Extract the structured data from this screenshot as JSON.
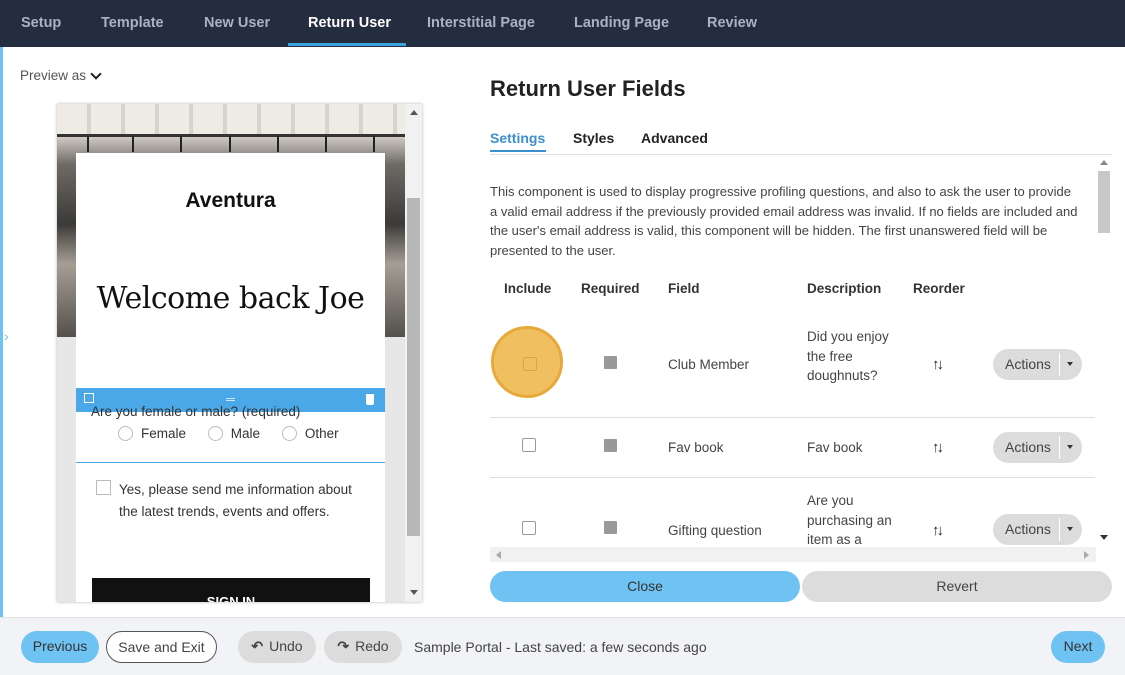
{
  "topnav": {
    "tabs": [
      "Setup",
      "Template",
      "New User",
      "Return User",
      "Interstitial Page",
      "Landing Page",
      "Review"
    ],
    "active": "Return User"
  },
  "preview": {
    "label": "Preview as",
    "brand": "Aventura",
    "welcome": "Welcome back Joe",
    "question": "Are you female or male? (required)",
    "options": [
      "Female",
      "Male",
      "Other"
    ],
    "optin": "Yes, please send me information about the latest trends, events and offers.",
    "signin": "SIGN IN"
  },
  "panel": {
    "title": "Return User Fields",
    "tabs": [
      "Settings",
      "Styles",
      "Advanced"
    ],
    "description": "This component is used to display progressive profiling questions, and also to ask the user to provide a valid email address if the previously provided email address was invalid. If no fields are included and the user's email address is valid, this component will be hidden. The first unanswered field will be presented to the user.",
    "columns": [
      "Include",
      "Required",
      "Field",
      "Description",
      "Reorder"
    ],
    "rows": [
      {
        "field": "Club Member",
        "description": "Did you enjoy the free doughnuts?",
        "action": "Actions"
      },
      {
        "field": "Fav book",
        "description": "Fav book",
        "action": "Actions"
      },
      {
        "field": "Gifting question",
        "description": "Are you purchasing an item as a",
        "action": "Actions"
      }
    ],
    "close": "Close",
    "revert": "Revert"
  },
  "footer": {
    "previous": "Previous",
    "save_exit": "Save and Exit",
    "undo": "Undo",
    "redo": "Redo",
    "status": "Sample Portal - Last saved: a few seconds ago",
    "next": "Next"
  },
  "colors": {
    "nav_bg": "#232d3f",
    "accent": "#3ba3e0",
    "button_blue": "#6fc3f2",
    "highlight": "#f0c060"
  }
}
